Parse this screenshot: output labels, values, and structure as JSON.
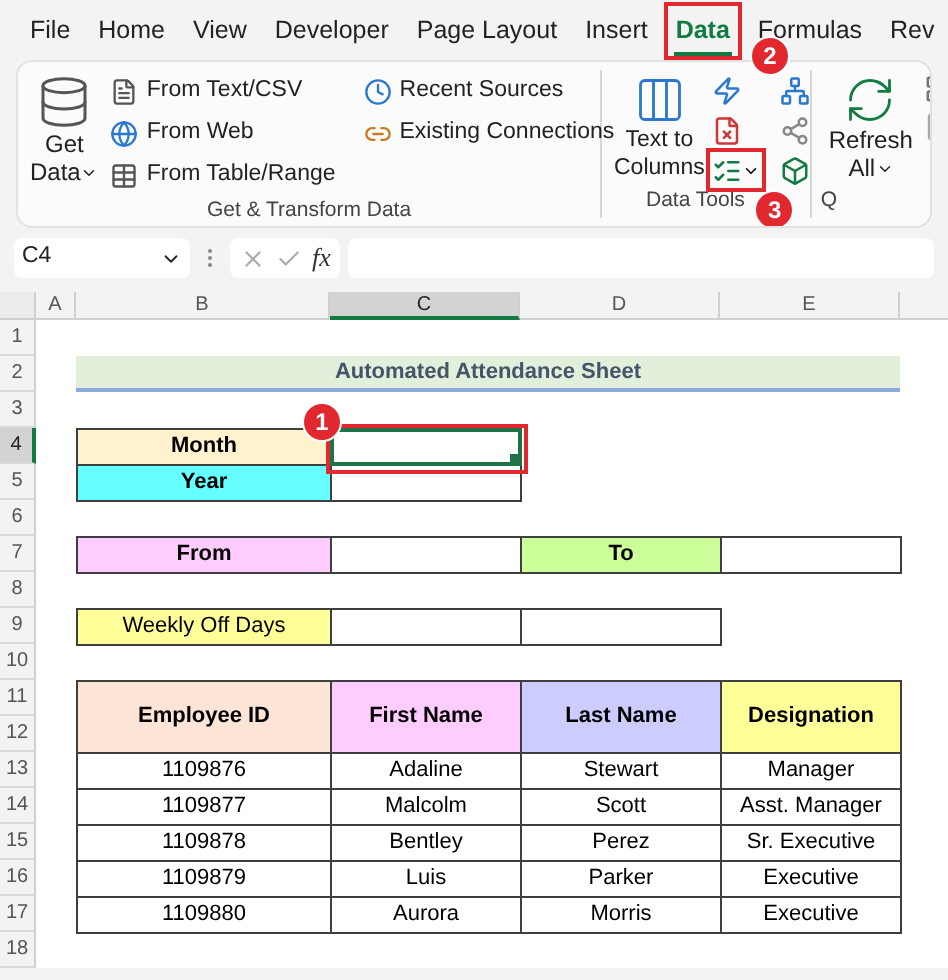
{
  "menu_tabs": [
    {
      "label": "File",
      "selected": false
    },
    {
      "label": "Home",
      "selected": false
    },
    {
      "label": "View",
      "selected": false
    },
    {
      "label": "Developer",
      "selected": false
    },
    {
      "label": "Page Layout",
      "selected": false
    },
    {
      "label": "Insert",
      "selected": false
    },
    {
      "label": "Data",
      "selected": true
    },
    {
      "label": "Formulas",
      "selected": false
    },
    {
      "label": "Rev",
      "selected": false
    }
  ],
  "ribbon": {
    "get_transform": {
      "get_data": [
        "Get",
        "Data"
      ],
      "commands": [
        {
          "label": "From Text/CSV",
          "kind": "text_file"
        },
        {
          "label": "From Web",
          "kind": "web"
        },
        {
          "label": "From Table/Range",
          "kind": "table"
        }
      ],
      "sources": [
        {
          "label": "Recent Sources",
          "kind": "recent"
        },
        {
          "label": "Existing Connections",
          "kind": "connections"
        }
      ],
      "label": "Get & Transform Data"
    },
    "data_tools": {
      "text_to_columns": [
        "Text to",
        "Columns"
      ],
      "label": "Data Tools"
    },
    "queries": {
      "refresh_all": [
        "Refresh",
        "All"
      ],
      "label": "Q"
    }
  },
  "formula_bar": {
    "name_box": "C4",
    "function_label": "fx"
  },
  "callouts": [
    {
      "number": "2",
      "kind": "tab"
    },
    {
      "number": "3",
      "kind": "tool"
    },
    {
      "number": "1",
      "kind": "cell"
    }
  ],
  "sheet": {
    "columns": [
      {
        "label": "A",
        "selected": false
      },
      {
        "label": "B",
        "selected": false
      },
      {
        "label": "C",
        "selected": true
      },
      {
        "label": "D",
        "selected": false
      },
      {
        "label": "E",
        "selected": false
      }
    ],
    "rows": [
      {
        "label": "1",
        "selected": false
      },
      {
        "label": "2",
        "selected": false
      },
      {
        "label": "3",
        "selected": false
      },
      {
        "label": "4",
        "selected": true
      },
      {
        "label": "5",
        "selected": false
      },
      {
        "label": "6",
        "selected": false
      },
      {
        "label": "7",
        "selected": false
      },
      {
        "label": "8",
        "selected": false
      },
      {
        "label": "9",
        "selected": false
      },
      {
        "label": "10",
        "selected": false
      },
      {
        "label": "11",
        "selected": false
      },
      {
        "label": "12",
        "selected": false
      },
      {
        "label": "13",
        "selected": false
      },
      {
        "label": "14",
        "selected": false
      },
      {
        "label": "15",
        "selected": false
      },
      {
        "label": "16",
        "selected": false
      },
      {
        "label": "17",
        "selected": false
      },
      {
        "label": "18",
        "selected": false
      }
    ],
    "title": "Automated Attendance Sheet",
    "period_fields": [
      {
        "label": "Month",
        "color": "#fff2cc",
        "selected": true
      },
      {
        "label": "Year",
        "color": "#66ffff",
        "selected": false
      }
    ],
    "range_fields": [
      {
        "label": "From",
        "color": "#ffccff"
      },
      {
        "label": "To",
        "color": "#ccff99"
      }
    ],
    "weekly_off": {
      "label": "Weekly Off Days",
      "color": "#ffff99"
    },
    "employee_table": {
      "columns": [
        {
          "label": "Employee ID",
          "color": "#fce4d6"
        },
        {
          "label": "First Name",
          "color": "#ffccff"
        },
        {
          "label": "Last Name",
          "color": "#ccccff"
        },
        {
          "label": "Designation",
          "color": "#ffff99"
        }
      ],
      "rows": [
        [
          "1109876",
          "Adaline",
          "Stewart",
          "Manager"
        ],
        [
          "1109877",
          "Malcolm",
          "Scott",
          "Asst. Manager"
        ],
        [
          "1109878",
          "Bentley",
          "Perez",
          "Sr. Executive"
        ],
        [
          "1109879",
          "Luis",
          "Parker",
          "Executive"
        ],
        [
          "1109880",
          "Aurora",
          "Morris",
          "Executive"
        ]
      ]
    }
  }
}
